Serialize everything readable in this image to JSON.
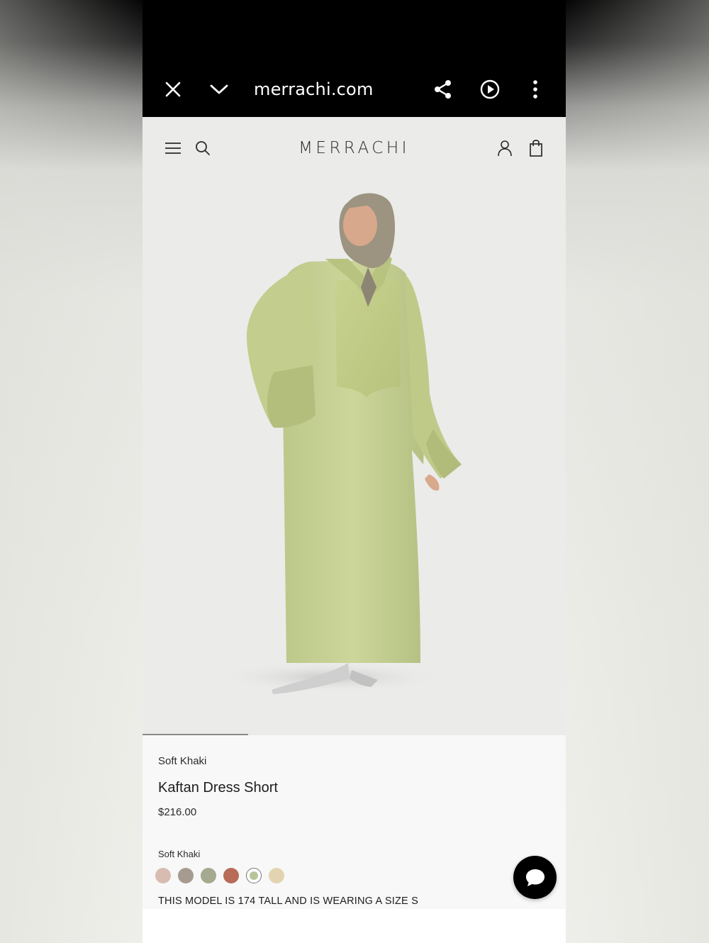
{
  "browser": {
    "url": "merrachi.com",
    "icons": [
      "close-icon",
      "chevron-down-icon",
      "share-icon",
      "play-icon",
      "more-vertical-icon"
    ]
  },
  "site": {
    "logo": "MERRACHI",
    "icons": [
      "menu-icon",
      "search-icon",
      "account-icon",
      "bag-icon"
    ]
  },
  "product": {
    "image_alt": "Model wearing green kaftan dress",
    "color_name": "Soft Khaki",
    "title": "Kaftan Dress Short",
    "price": "$216.00",
    "selected_color_label": "Soft Khaki",
    "swatches": [
      {
        "name": "blush",
        "color": "#d8bcb1"
      },
      {
        "name": "taupe",
        "color": "#a59b90"
      },
      {
        "name": "sage",
        "color": "#a4a98f"
      },
      {
        "name": "terracotta",
        "color": "#b86b57"
      },
      {
        "name": "soft-khaki",
        "color": "#b9c49a",
        "selected": true
      },
      {
        "name": "sand",
        "color": "#e2d4b1"
      }
    ],
    "model_note": "THIS MODEL IS 174 TALL AND IS WEARING A SIZE S"
  },
  "chat": {
    "icon": "chat-icon"
  }
}
